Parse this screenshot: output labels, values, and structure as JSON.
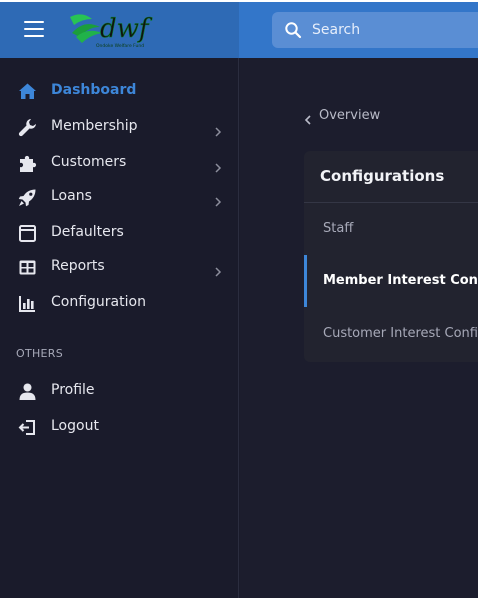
{
  "header": {
    "logo_text": "dwf",
    "logo_tagline": "Ondoke Welfare Fund",
    "search_placeholder": "Search"
  },
  "sidebar": {
    "items": [
      {
        "label": "Dashboard",
        "icon": "home-icon",
        "active": true,
        "has_children": false
      },
      {
        "label": "Membership",
        "icon": "wrench-icon",
        "active": false,
        "has_children": true
      },
      {
        "label": "Customers",
        "icon": "puzzle-icon",
        "active": false,
        "has_children": true
      },
      {
        "label": "Loans",
        "icon": "rocket-icon",
        "active": false,
        "has_children": true
      },
      {
        "label": "Defaulters",
        "icon": "window-icon",
        "active": false,
        "has_children": false
      },
      {
        "label": "Reports",
        "icon": "grid-icon",
        "active": false,
        "has_children": true
      },
      {
        "label": "Configuration",
        "icon": "bar-chart-icon",
        "active": false,
        "has_children": false
      }
    ],
    "section_title": "OTHERS",
    "other_items": [
      {
        "label": "Profile",
        "icon": "user-icon"
      },
      {
        "label": "Logout",
        "icon": "logout-icon"
      }
    ]
  },
  "main": {
    "back_label": "Overview",
    "card": {
      "title": "Configurations",
      "menu": [
        {
          "label": "Staff",
          "active": false
        },
        {
          "label": "Member Interest Config",
          "active": true
        },
        {
          "label": "Customer Interest Config",
          "active": false
        }
      ]
    }
  },
  "colors": {
    "accent": "#3d86d8",
    "topbar": "#2e6ab5",
    "background": "#1a1b2b",
    "card": "#22232f"
  }
}
